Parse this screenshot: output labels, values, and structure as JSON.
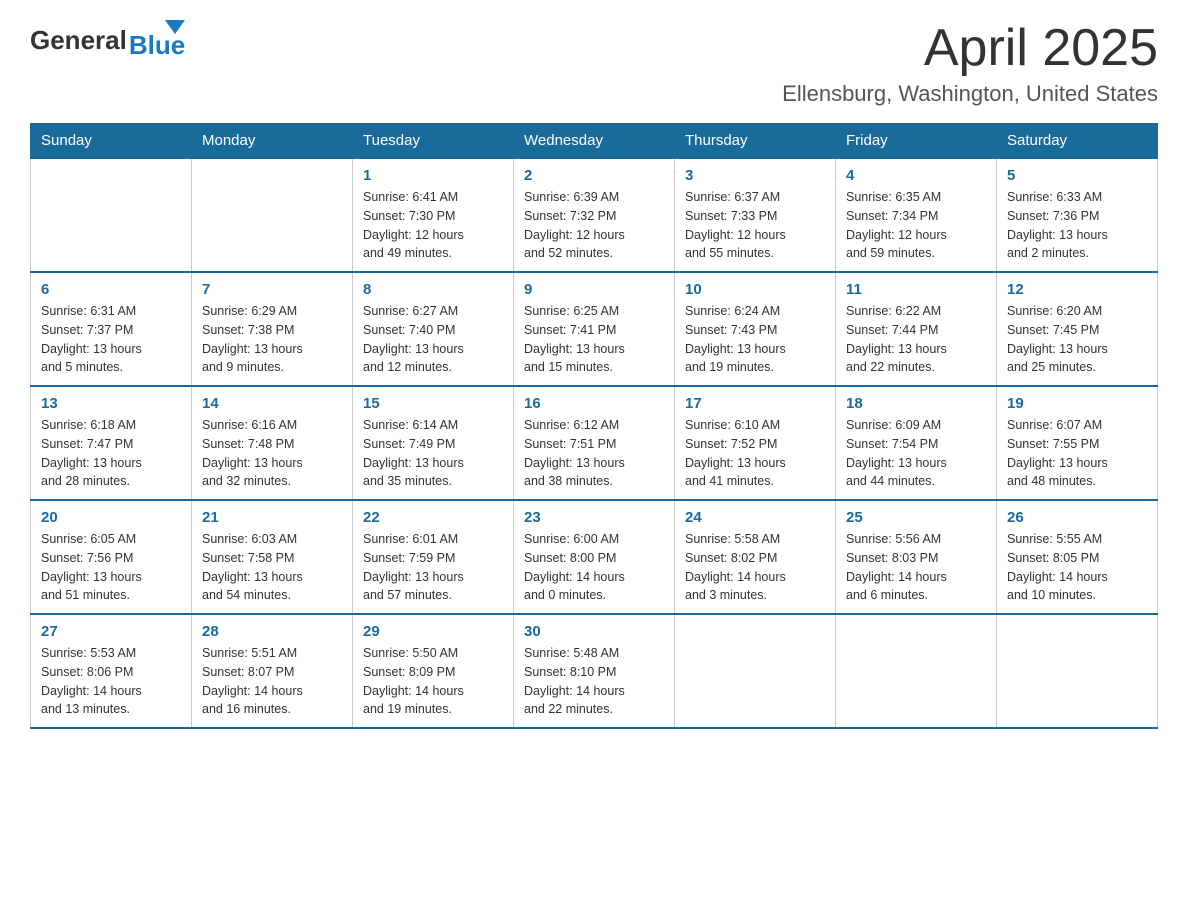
{
  "header": {
    "logo_general": "General",
    "logo_blue": "Blue",
    "month_title": "April 2025",
    "location": "Ellensburg, Washington, United States"
  },
  "weekdays": [
    "Sunday",
    "Monday",
    "Tuesday",
    "Wednesday",
    "Thursday",
    "Friday",
    "Saturday"
  ],
  "weeks": [
    [
      {
        "day": "",
        "info": ""
      },
      {
        "day": "",
        "info": ""
      },
      {
        "day": "1",
        "info": "Sunrise: 6:41 AM\nSunset: 7:30 PM\nDaylight: 12 hours\nand 49 minutes."
      },
      {
        "day": "2",
        "info": "Sunrise: 6:39 AM\nSunset: 7:32 PM\nDaylight: 12 hours\nand 52 minutes."
      },
      {
        "day": "3",
        "info": "Sunrise: 6:37 AM\nSunset: 7:33 PM\nDaylight: 12 hours\nand 55 minutes."
      },
      {
        "day": "4",
        "info": "Sunrise: 6:35 AM\nSunset: 7:34 PM\nDaylight: 12 hours\nand 59 minutes."
      },
      {
        "day": "5",
        "info": "Sunrise: 6:33 AM\nSunset: 7:36 PM\nDaylight: 13 hours\nand 2 minutes."
      }
    ],
    [
      {
        "day": "6",
        "info": "Sunrise: 6:31 AM\nSunset: 7:37 PM\nDaylight: 13 hours\nand 5 minutes."
      },
      {
        "day": "7",
        "info": "Sunrise: 6:29 AM\nSunset: 7:38 PM\nDaylight: 13 hours\nand 9 minutes."
      },
      {
        "day": "8",
        "info": "Sunrise: 6:27 AM\nSunset: 7:40 PM\nDaylight: 13 hours\nand 12 minutes."
      },
      {
        "day": "9",
        "info": "Sunrise: 6:25 AM\nSunset: 7:41 PM\nDaylight: 13 hours\nand 15 minutes."
      },
      {
        "day": "10",
        "info": "Sunrise: 6:24 AM\nSunset: 7:43 PM\nDaylight: 13 hours\nand 19 minutes."
      },
      {
        "day": "11",
        "info": "Sunrise: 6:22 AM\nSunset: 7:44 PM\nDaylight: 13 hours\nand 22 minutes."
      },
      {
        "day": "12",
        "info": "Sunrise: 6:20 AM\nSunset: 7:45 PM\nDaylight: 13 hours\nand 25 minutes."
      }
    ],
    [
      {
        "day": "13",
        "info": "Sunrise: 6:18 AM\nSunset: 7:47 PM\nDaylight: 13 hours\nand 28 minutes."
      },
      {
        "day": "14",
        "info": "Sunrise: 6:16 AM\nSunset: 7:48 PM\nDaylight: 13 hours\nand 32 minutes."
      },
      {
        "day": "15",
        "info": "Sunrise: 6:14 AM\nSunset: 7:49 PM\nDaylight: 13 hours\nand 35 minutes."
      },
      {
        "day": "16",
        "info": "Sunrise: 6:12 AM\nSunset: 7:51 PM\nDaylight: 13 hours\nand 38 minutes."
      },
      {
        "day": "17",
        "info": "Sunrise: 6:10 AM\nSunset: 7:52 PM\nDaylight: 13 hours\nand 41 minutes."
      },
      {
        "day": "18",
        "info": "Sunrise: 6:09 AM\nSunset: 7:54 PM\nDaylight: 13 hours\nand 44 minutes."
      },
      {
        "day": "19",
        "info": "Sunrise: 6:07 AM\nSunset: 7:55 PM\nDaylight: 13 hours\nand 48 minutes."
      }
    ],
    [
      {
        "day": "20",
        "info": "Sunrise: 6:05 AM\nSunset: 7:56 PM\nDaylight: 13 hours\nand 51 minutes."
      },
      {
        "day": "21",
        "info": "Sunrise: 6:03 AM\nSunset: 7:58 PM\nDaylight: 13 hours\nand 54 minutes."
      },
      {
        "day": "22",
        "info": "Sunrise: 6:01 AM\nSunset: 7:59 PM\nDaylight: 13 hours\nand 57 minutes."
      },
      {
        "day": "23",
        "info": "Sunrise: 6:00 AM\nSunset: 8:00 PM\nDaylight: 14 hours\nand 0 minutes."
      },
      {
        "day": "24",
        "info": "Sunrise: 5:58 AM\nSunset: 8:02 PM\nDaylight: 14 hours\nand 3 minutes."
      },
      {
        "day": "25",
        "info": "Sunrise: 5:56 AM\nSunset: 8:03 PM\nDaylight: 14 hours\nand 6 minutes."
      },
      {
        "day": "26",
        "info": "Sunrise: 5:55 AM\nSunset: 8:05 PM\nDaylight: 14 hours\nand 10 minutes."
      }
    ],
    [
      {
        "day": "27",
        "info": "Sunrise: 5:53 AM\nSunset: 8:06 PM\nDaylight: 14 hours\nand 13 minutes."
      },
      {
        "day": "28",
        "info": "Sunrise: 5:51 AM\nSunset: 8:07 PM\nDaylight: 14 hours\nand 16 minutes."
      },
      {
        "day": "29",
        "info": "Sunrise: 5:50 AM\nSunset: 8:09 PM\nDaylight: 14 hours\nand 19 minutes."
      },
      {
        "day": "30",
        "info": "Sunrise: 5:48 AM\nSunset: 8:10 PM\nDaylight: 14 hours\nand 22 minutes."
      },
      {
        "day": "",
        "info": ""
      },
      {
        "day": "",
        "info": ""
      },
      {
        "day": "",
        "info": ""
      }
    ]
  ]
}
